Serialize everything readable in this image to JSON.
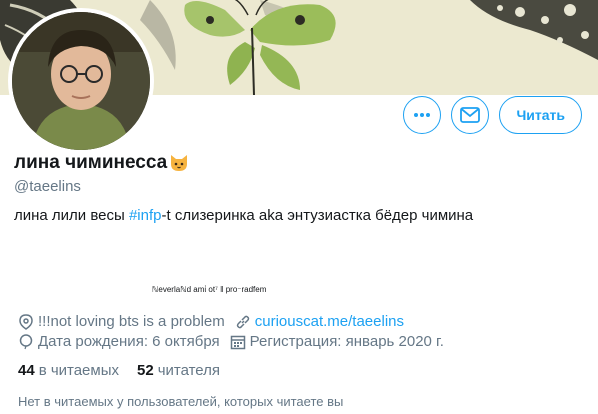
{
  "profile": {
    "display_name": "лина чиминесса",
    "name_emoji": "cat-face-emoji",
    "handle": "@taeelins",
    "bio_before": "лина лили весы ",
    "bio_hashtag": "#infp",
    "bio_after": "-t слизеринка aka энтузиастка бёдер чимина",
    "tiny_line": "ℕeverlaℕd amἰ ot⁷ ‖ pro⁻radfem",
    "location": "!!!not loving bts is a problem",
    "website": "curiouscat.me/taeelins",
    "birthday": "Дата рождения: 6 октября",
    "joined": "Регистрация: январь 2020 г."
  },
  "stats": {
    "following_count": "44",
    "following_label": "в читаемых",
    "followers_count": "52",
    "followers_label": "читателя"
  },
  "followers_you_know": "Нет в читаемых у пользователей, которых читаете вы",
  "actions": {
    "more_icon": "more-dots-icon",
    "message_icon": "envelope-icon",
    "follow_label": "Читать"
  },
  "colors": {
    "accent": "#1da1f2",
    "muted": "#657786",
    "text": "#14171a",
    "banner_bg": "#ece9d0"
  }
}
